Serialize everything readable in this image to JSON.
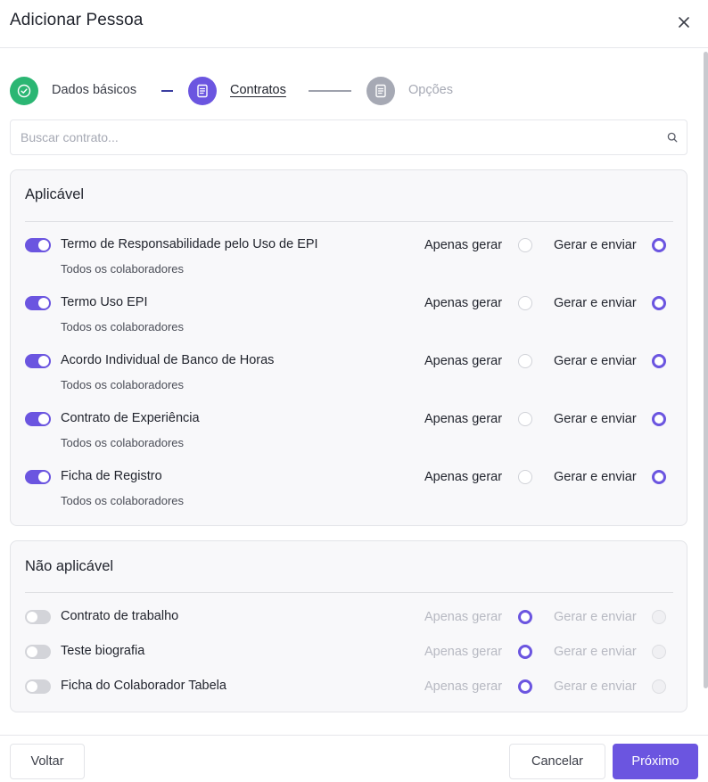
{
  "header": {
    "title": "Adicionar Pessoa"
  },
  "stepper": {
    "steps": [
      {
        "label": "Dados básicos"
      },
      {
        "label": "Contratos"
      },
      {
        "label": "Opções"
      }
    ]
  },
  "search": {
    "placeholder": "Buscar contrato..."
  },
  "applicable": {
    "title": "Aplicável",
    "items": [
      {
        "name": "Termo de Responsabilidade pelo Uso de EPI",
        "sub": "Todos os colaboradores",
        "opt1": "Apenas gerar",
        "opt2": "Gerar e enviar"
      },
      {
        "name": "Termo Uso EPI",
        "sub": "Todos os colaboradores",
        "opt1": "Apenas gerar",
        "opt2": "Gerar e enviar"
      },
      {
        "name": "Acordo Individual de Banco de Horas",
        "sub": "Todos os colaboradores",
        "opt1": "Apenas gerar",
        "opt2": "Gerar e enviar"
      },
      {
        "name": "Contrato de Experiência",
        "sub": "Todos os colaboradores",
        "opt1": "Apenas gerar",
        "opt2": "Gerar e enviar"
      },
      {
        "name": "Ficha de Registro",
        "sub": "Todos os colaboradores",
        "opt1": "Apenas gerar",
        "opt2": "Gerar e enviar"
      }
    ]
  },
  "not_applicable": {
    "title": "Não aplicável",
    "items": [
      {
        "name": "Contrato de trabalho",
        "opt1": "Apenas gerar",
        "opt2": "Gerar e enviar"
      },
      {
        "name": "Teste biografia",
        "opt1": "Apenas gerar",
        "opt2": "Gerar e enviar"
      },
      {
        "name": "Ficha do Colaborador Tabela",
        "opt1": "Apenas gerar",
        "opt2": "Gerar e enviar"
      }
    ]
  },
  "footer": {
    "back": "Voltar",
    "cancel": "Cancelar",
    "next": "Próximo"
  },
  "colors": {
    "accent": "#6b55e0",
    "success": "#2bb673",
    "inactive_step": "#a6a9b4"
  }
}
